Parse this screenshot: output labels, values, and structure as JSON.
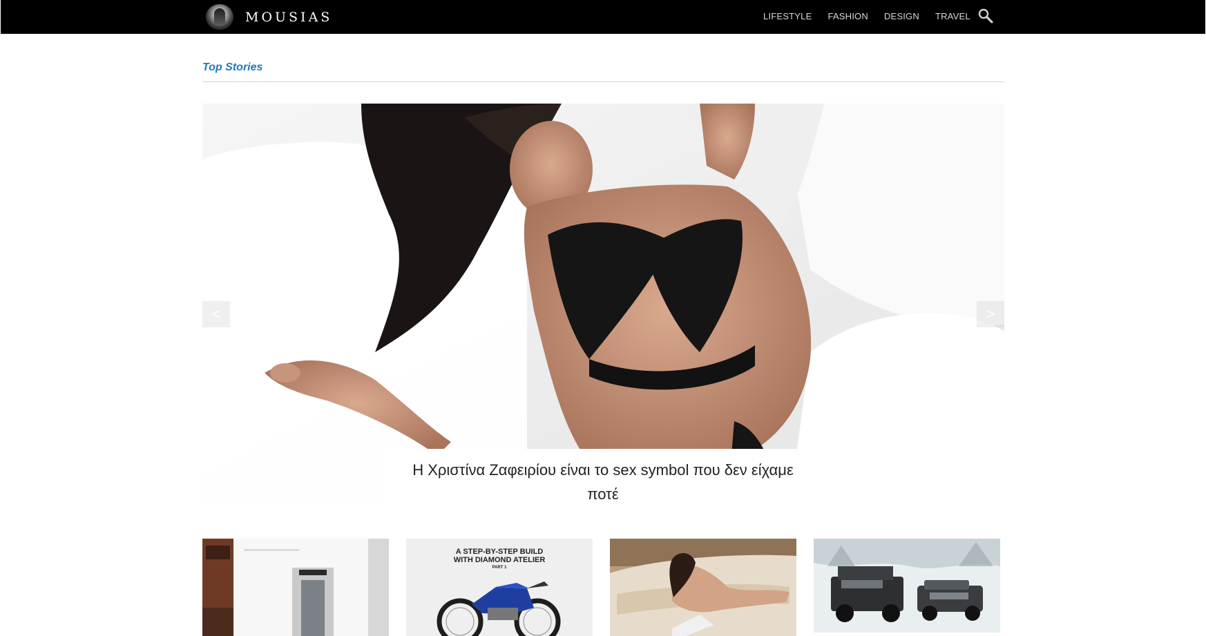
{
  "site": {
    "brand": "MOUSIAS",
    "logo_icon": "helmet-logo-icon"
  },
  "nav": {
    "items": [
      {
        "label": "LIFESTYLE"
      },
      {
        "label": "FASHION"
      },
      {
        "label": "DESIGN"
      },
      {
        "label": "TRAVEL"
      }
    ],
    "search_icon": "search-icon"
  },
  "section": {
    "title": "Top Stories"
  },
  "hero": {
    "caption": "Η Χριστίνα Ζαφειρίου είναι το sex symbol που δεν είχαμε ποτέ",
    "prev_label": "<",
    "next_label": ">"
  },
  "thumbnails": [
    {
      "image": "white-building-photo",
      "title": "",
      "subtitle": ""
    },
    {
      "image": "motorcycle-photo",
      "title": "A STEP-BY-STEP BUILD\nWITH DIAMOND ATELIER",
      "subtitle": "PART 1"
    },
    {
      "image": "woman-on-sofa-photo",
      "title": "",
      "subtitle": ""
    },
    {
      "image": "offroad-vehicles-snow-photo",
      "title": "",
      "subtitle": ""
    }
  ],
  "colors": {
    "topbar": "#000000",
    "accent": "#1c7ab8",
    "caption_bg": "#ffffff"
  }
}
